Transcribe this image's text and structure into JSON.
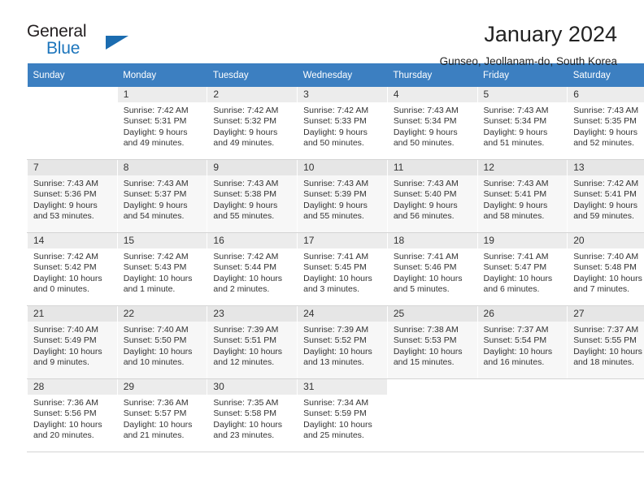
{
  "brand": {
    "name_part1": "General",
    "name_part2": "Blue",
    "logo_icon": "triangle-logo-icon"
  },
  "header": {
    "title": "January 2024",
    "location": "Gunseo, Jeollanam-do, South Korea"
  },
  "weekday_headers": [
    "Sunday",
    "Monday",
    "Tuesday",
    "Wednesday",
    "Thursday",
    "Friday",
    "Saturday"
  ],
  "weeks": [
    [
      {
        "day": "",
        "lines": []
      },
      {
        "day": "1",
        "lines": [
          "Sunrise: 7:42 AM",
          "Sunset: 5:31 PM",
          "Daylight: 9 hours",
          "and 49 minutes."
        ]
      },
      {
        "day": "2",
        "lines": [
          "Sunrise: 7:42 AM",
          "Sunset: 5:32 PM",
          "Daylight: 9 hours",
          "and 49 minutes."
        ]
      },
      {
        "day": "3",
        "lines": [
          "Sunrise: 7:42 AM",
          "Sunset: 5:33 PM",
          "Daylight: 9 hours",
          "and 50 minutes."
        ]
      },
      {
        "day": "4",
        "lines": [
          "Sunrise: 7:43 AM",
          "Sunset: 5:34 PM",
          "Daylight: 9 hours",
          "and 50 minutes."
        ]
      },
      {
        "day": "5",
        "lines": [
          "Sunrise: 7:43 AM",
          "Sunset: 5:34 PM",
          "Daylight: 9 hours",
          "and 51 minutes."
        ]
      },
      {
        "day": "6",
        "lines": [
          "Sunrise: 7:43 AM",
          "Sunset: 5:35 PM",
          "Daylight: 9 hours",
          "and 52 minutes."
        ]
      }
    ],
    [
      {
        "day": "7",
        "lines": [
          "Sunrise: 7:43 AM",
          "Sunset: 5:36 PM",
          "Daylight: 9 hours",
          "and 53 minutes."
        ]
      },
      {
        "day": "8",
        "lines": [
          "Sunrise: 7:43 AM",
          "Sunset: 5:37 PM",
          "Daylight: 9 hours",
          "and 54 minutes."
        ]
      },
      {
        "day": "9",
        "lines": [
          "Sunrise: 7:43 AM",
          "Sunset: 5:38 PM",
          "Daylight: 9 hours",
          "and 55 minutes."
        ]
      },
      {
        "day": "10",
        "lines": [
          "Sunrise: 7:43 AM",
          "Sunset: 5:39 PM",
          "Daylight: 9 hours",
          "and 55 minutes."
        ]
      },
      {
        "day": "11",
        "lines": [
          "Sunrise: 7:43 AM",
          "Sunset: 5:40 PM",
          "Daylight: 9 hours",
          "and 56 minutes."
        ]
      },
      {
        "day": "12",
        "lines": [
          "Sunrise: 7:43 AM",
          "Sunset: 5:41 PM",
          "Daylight: 9 hours",
          "and 58 minutes."
        ]
      },
      {
        "day": "13",
        "lines": [
          "Sunrise: 7:42 AM",
          "Sunset: 5:41 PM",
          "Daylight: 9 hours",
          "and 59 minutes."
        ]
      }
    ],
    [
      {
        "day": "14",
        "lines": [
          "Sunrise: 7:42 AM",
          "Sunset: 5:42 PM",
          "Daylight: 10 hours",
          "and 0 minutes."
        ]
      },
      {
        "day": "15",
        "lines": [
          "Sunrise: 7:42 AM",
          "Sunset: 5:43 PM",
          "Daylight: 10 hours",
          "and 1 minute."
        ]
      },
      {
        "day": "16",
        "lines": [
          "Sunrise: 7:42 AM",
          "Sunset: 5:44 PM",
          "Daylight: 10 hours",
          "and 2 minutes."
        ]
      },
      {
        "day": "17",
        "lines": [
          "Sunrise: 7:41 AM",
          "Sunset: 5:45 PM",
          "Daylight: 10 hours",
          "and 3 minutes."
        ]
      },
      {
        "day": "18",
        "lines": [
          "Sunrise: 7:41 AM",
          "Sunset: 5:46 PM",
          "Daylight: 10 hours",
          "and 5 minutes."
        ]
      },
      {
        "day": "19",
        "lines": [
          "Sunrise: 7:41 AM",
          "Sunset: 5:47 PM",
          "Daylight: 10 hours",
          "and 6 minutes."
        ]
      },
      {
        "day": "20",
        "lines": [
          "Sunrise: 7:40 AM",
          "Sunset: 5:48 PM",
          "Daylight: 10 hours",
          "and 7 minutes."
        ]
      }
    ],
    [
      {
        "day": "21",
        "lines": [
          "Sunrise: 7:40 AM",
          "Sunset: 5:49 PM",
          "Daylight: 10 hours",
          "and 9 minutes."
        ]
      },
      {
        "day": "22",
        "lines": [
          "Sunrise: 7:40 AM",
          "Sunset: 5:50 PM",
          "Daylight: 10 hours",
          "and 10 minutes."
        ]
      },
      {
        "day": "23",
        "lines": [
          "Sunrise: 7:39 AM",
          "Sunset: 5:51 PM",
          "Daylight: 10 hours",
          "and 12 minutes."
        ]
      },
      {
        "day": "24",
        "lines": [
          "Sunrise: 7:39 AM",
          "Sunset: 5:52 PM",
          "Daylight: 10 hours",
          "and 13 minutes."
        ]
      },
      {
        "day": "25",
        "lines": [
          "Sunrise: 7:38 AM",
          "Sunset: 5:53 PM",
          "Daylight: 10 hours",
          "and 15 minutes."
        ]
      },
      {
        "day": "26",
        "lines": [
          "Sunrise: 7:37 AM",
          "Sunset: 5:54 PM",
          "Daylight: 10 hours",
          "and 16 minutes."
        ]
      },
      {
        "day": "27",
        "lines": [
          "Sunrise: 7:37 AM",
          "Sunset: 5:55 PM",
          "Daylight: 10 hours",
          "and 18 minutes."
        ]
      }
    ],
    [
      {
        "day": "28",
        "lines": [
          "Sunrise: 7:36 AM",
          "Sunset: 5:56 PM",
          "Daylight: 10 hours",
          "and 20 minutes."
        ]
      },
      {
        "day": "29",
        "lines": [
          "Sunrise: 7:36 AM",
          "Sunset: 5:57 PM",
          "Daylight: 10 hours",
          "and 21 minutes."
        ]
      },
      {
        "day": "30",
        "lines": [
          "Sunrise: 7:35 AM",
          "Sunset: 5:58 PM",
          "Daylight: 10 hours",
          "and 23 minutes."
        ]
      },
      {
        "day": "31",
        "lines": [
          "Sunrise: 7:34 AM",
          "Sunset: 5:59 PM",
          "Daylight: 10 hours",
          "and 25 minutes."
        ]
      },
      {
        "day": "",
        "lines": []
      },
      {
        "day": "",
        "lines": []
      },
      {
        "day": "",
        "lines": []
      }
    ]
  ],
  "colors": {
    "header_blue": "#3c7fc1",
    "brand_blue": "#1c75bc",
    "daynum_band": "#ececec",
    "alt_row": "#f7f7f7"
  }
}
